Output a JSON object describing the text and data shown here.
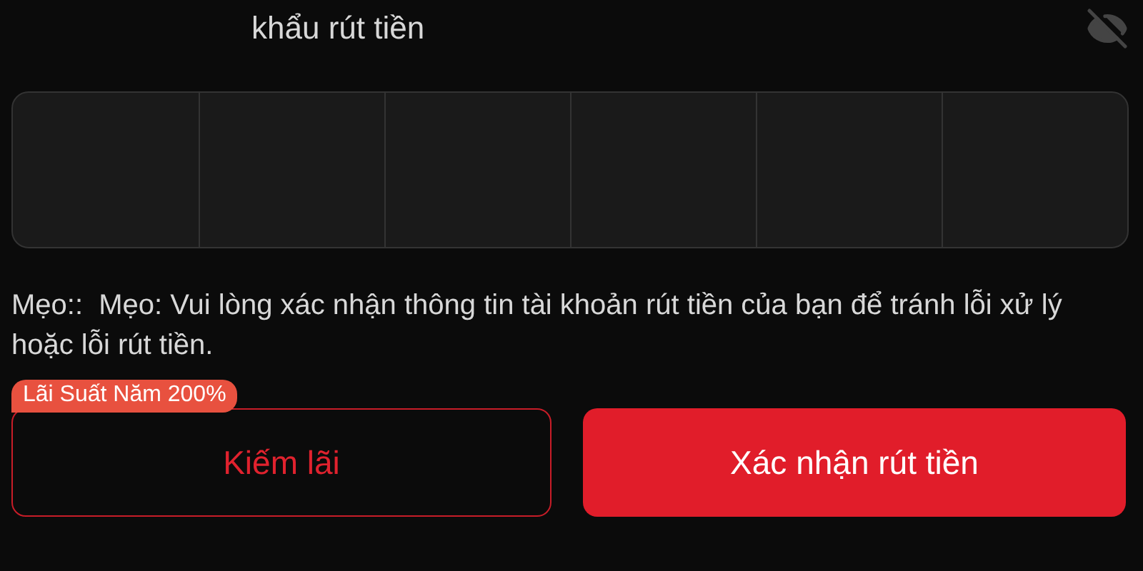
{
  "password_field": {
    "label": "khẩu rút tiền",
    "visible": false,
    "cells": [
      {
        "filled": false
      },
      {
        "filled": false
      },
      {
        "filled": false
      },
      {
        "filled": false
      },
      {
        "filled": false
      },
      {
        "filled": false
      }
    ]
  },
  "tip": "Mẹo::  Mẹo: Vui lòng xác nhận thông tin tài khoản rút tiền của bạn để tránh lỗi xử lý hoặc lỗi rút tiền.",
  "buttons": [
    {
      "kind": "outline",
      "label": "Kiếm lãi",
      "badge": "Lãi Suất Năm 200%"
    },
    {
      "kind": "primary",
      "label": "Xác nhận rút tiền"
    }
  ]
}
